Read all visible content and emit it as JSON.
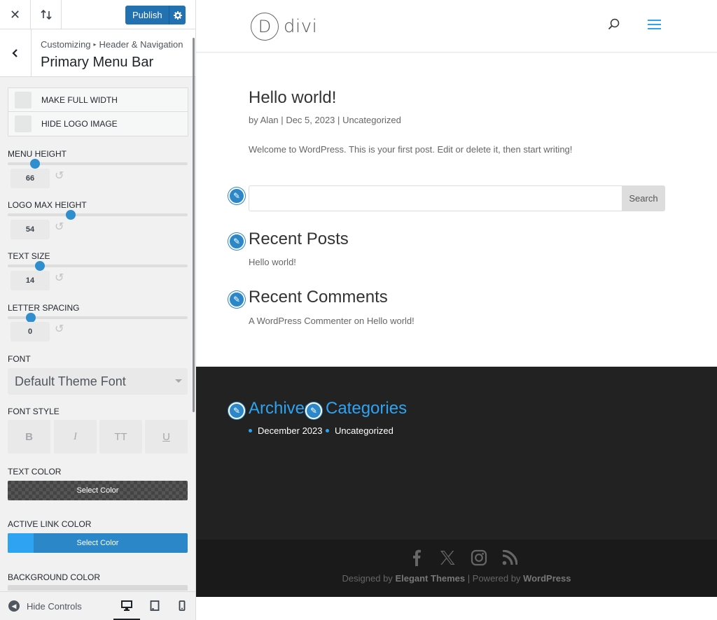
{
  "topbar": {
    "publish_label": "Publish"
  },
  "section": {
    "breadcrumb_root": "Customizing",
    "breadcrumb_parent": "Header & Navigation",
    "title": "Primary Menu Bar"
  },
  "checkboxes": [
    {
      "label": "MAKE FULL WIDTH",
      "checked": false
    },
    {
      "label": "HIDE LOGO IMAGE",
      "checked": false
    }
  ],
  "controls": {
    "menu_height": {
      "label": "MENU HEIGHT",
      "value": "66",
      "level": 0.15
    },
    "logo_max_height": {
      "label": "LOGO MAX HEIGHT",
      "value": "54",
      "level": 0.35
    },
    "text_size": {
      "label": "TEXT SIZE",
      "value": "14",
      "level": 0.18
    },
    "letter_spacing": {
      "label": "LETTER SPACING",
      "value": "0",
      "level": 0.13
    },
    "font": {
      "label": "FONT",
      "value": "Default Theme Font"
    },
    "font_style": {
      "label": "FONT STYLE",
      "buttons": [
        "B",
        "I",
        "TT",
        "U"
      ]
    },
    "text_color": {
      "label": "TEXT COLOR",
      "button": "Select Color"
    },
    "active_link_color": {
      "label": "ACTIVE LINK COLOR",
      "button": "Select Color",
      "color": "#2ea3f2"
    },
    "background_color": {
      "label": "BACKGROUND COLOR"
    }
  },
  "footer": {
    "hide_controls": "Hide Controls"
  },
  "preview": {
    "logo_letter": "D",
    "logo_text": "divi",
    "post": {
      "title": "Hello world!",
      "by": "by",
      "author": "Alan",
      "sep1": "|",
      "date": "Dec 5, 2023",
      "sep2": "|",
      "category": "Uncategorized",
      "body": "Welcome to WordPress. This is your first post. Edit or delete it, then start writing!"
    },
    "search_button": "Search",
    "recent_posts": {
      "title": "Recent Posts",
      "item": "Hello world!"
    },
    "recent_comments": {
      "title": "Recent Comments",
      "author": "A WordPress Commenter",
      "on": "on",
      "post": "Hello world!"
    },
    "footer_widgets": {
      "archives_title": "Archives",
      "archives_item": "December 2023",
      "categories_title": "Categories",
      "categories_item": "Uncategorized"
    },
    "credits": {
      "designed_by": "Designed by",
      "theme_author": "Elegant Themes",
      "sep": "|",
      "powered_by": "Powered by",
      "platform": "WordPress"
    },
    "accent": "#2ea3f2"
  }
}
